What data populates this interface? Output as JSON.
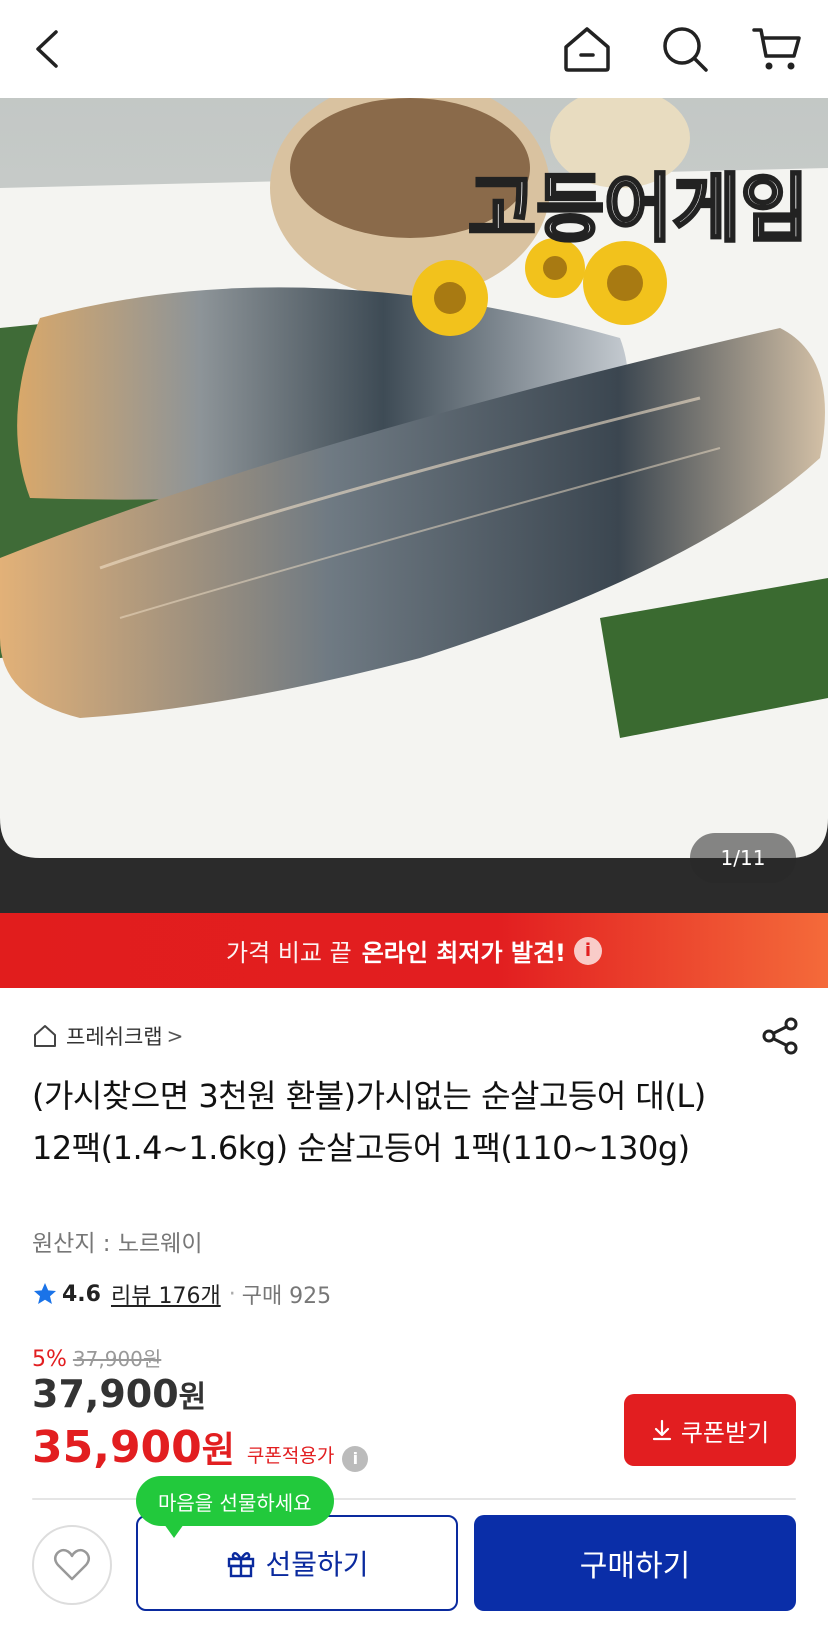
{
  "image_counter": "1/11",
  "hero_overlay_text": "고등어게임",
  "promo": {
    "pre": "가격 비교 끝",
    "strong": "온라인 최저가 발견!",
    "info_icon": "i"
  },
  "seller": {
    "name": "프레쉬크랩",
    "chevron": ">"
  },
  "product": {
    "title": "(가시찾으면 3천원 환불)가시없는 순살고등어 대(L) 12팩(1.4~1.6kg) 순살고등어 1팩(110~130g)",
    "origin": "원산지 : 노르웨이"
  },
  "rating": {
    "score": "4.6",
    "reviews": "리뷰 176개",
    "separator": "·",
    "purchases": "구매 925"
  },
  "price": {
    "discount_rate": "5%",
    "original": "37,900원",
    "current_num": "37,900",
    "current_unit": "원",
    "coupon_num": "35,900",
    "coupon_unit": "원",
    "coupon_label": "쿠폰적용가"
  },
  "coupon_button": "쿠폰받기",
  "tooltip": "마음을 선물하세요",
  "gift_button": "선물하기",
  "buy_button": "구매하기",
  "colors": {
    "accent_red": "#e21e20",
    "brand_blue": "#0a2ea8",
    "tooltip_green": "#22c93c"
  },
  "icons": [
    "back-icon",
    "home-icon",
    "search-icon",
    "cart-icon",
    "info-icon",
    "house-icon",
    "share-icon",
    "star-icon",
    "download-icon",
    "heart-icon",
    "gift-icon"
  ]
}
